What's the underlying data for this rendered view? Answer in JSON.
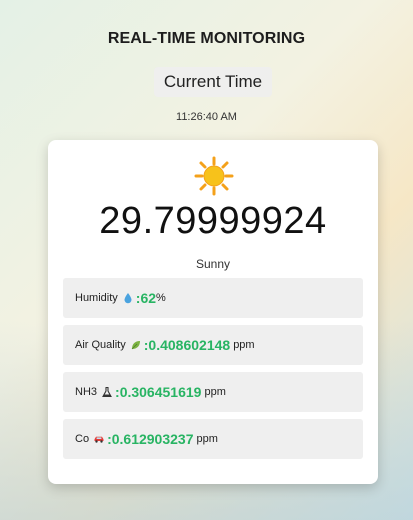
{
  "header": {
    "title": "REAL-TIME MONITORING",
    "time_label": "Current Time",
    "time_value": "11:26:40 AM"
  },
  "weather": {
    "icon": "sun-icon",
    "temperature": "29.79999924",
    "condition": "Sunny"
  },
  "readings": [
    {
      "label": "Humidity",
      "icon": "water-drop-icon",
      "sep": ":",
      "value": "62",
      "unit": "%"
    },
    {
      "label": "Air Quality",
      "icon": "leaf-icon",
      "sep": ":",
      "value": "0.408602148",
      "unit": "ppm"
    },
    {
      "label": "NH3",
      "icon": "flask-icon",
      "sep": ":",
      "value": "0.306451619",
      "unit": "ppm"
    },
    {
      "label": "Co",
      "icon": "car-icon",
      "sep": ":",
      "value": "0.612903237",
      "unit": "ppm"
    }
  ],
  "colors": {
    "value_green": "#28b463",
    "sun_yellow": "#f7c21b",
    "drop_blue": "#4aa3df",
    "car_red": "#e53935"
  }
}
